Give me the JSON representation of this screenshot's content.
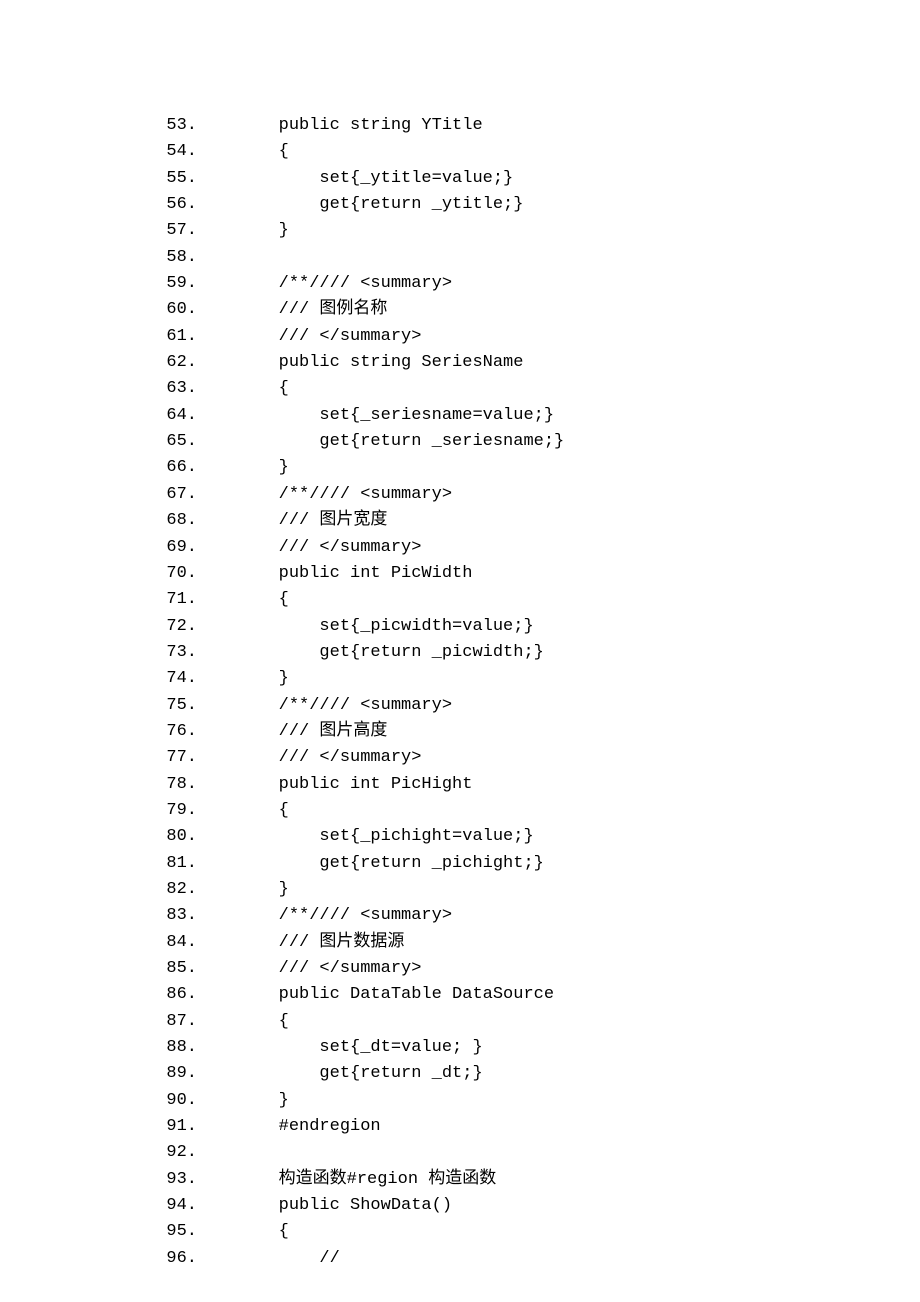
{
  "lines": [
    {
      "n": "53.",
      "t": "        public string YTitle"
    },
    {
      "n": "54.",
      "t": "        {"
    },
    {
      "n": "55.",
      "t": "            set{_ytitle=value;}"
    },
    {
      "n": "56.",
      "t": "            get{return _ytitle;}"
    },
    {
      "n": "57.",
      "t": "        }"
    },
    {
      "n": "58.",
      "t": "  "
    },
    {
      "n": "59.",
      "t": "        /**//// <summary>"
    },
    {
      "n": "60.",
      "t": "        /// 图例名称"
    },
    {
      "n": "61.",
      "t": "        /// </summary>"
    },
    {
      "n": "62.",
      "t": "        public string SeriesName"
    },
    {
      "n": "63.",
      "t": "        {"
    },
    {
      "n": "64.",
      "t": "            set{_seriesname=value;}"
    },
    {
      "n": "65.",
      "t": "            get{return _seriesname;}"
    },
    {
      "n": "66.",
      "t": "        }"
    },
    {
      "n": "67.",
      "t": "        /**//// <summary>"
    },
    {
      "n": "68.",
      "t": "        /// 图片宽度"
    },
    {
      "n": "69.",
      "t": "        /// </summary>"
    },
    {
      "n": "70.",
      "t": "        public int PicWidth"
    },
    {
      "n": "71.",
      "t": "        {"
    },
    {
      "n": "72.",
      "t": "            set{_picwidth=value;}"
    },
    {
      "n": "73.",
      "t": "            get{return _picwidth;}"
    },
    {
      "n": "74.",
      "t": "        }"
    },
    {
      "n": "75.",
      "t": "        /**//// <summary>"
    },
    {
      "n": "76.",
      "t": "        /// 图片高度"
    },
    {
      "n": "77.",
      "t": "        /// </summary>"
    },
    {
      "n": "78.",
      "t": "        public int PicHight"
    },
    {
      "n": "79.",
      "t": "        {"
    },
    {
      "n": "80.",
      "t": "            set{_pichight=value;}"
    },
    {
      "n": "81.",
      "t": "            get{return _pichight;}"
    },
    {
      "n": "82.",
      "t": "        }"
    },
    {
      "n": "83.",
      "t": "        /**//// <summary>"
    },
    {
      "n": "84.",
      "t": "        /// 图片数据源"
    },
    {
      "n": "85.",
      "t": "        /// </summary>"
    },
    {
      "n": "86.",
      "t": "        public DataTable DataSource"
    },
    {
      "n": "87.",
      "t": "        {"
    },
    {
      "n": "88.",
      "t": "            set{_dt=value; }"
    },
    {
      "n": "89.",
      "t": "            get{return _dt;}"
    },
    {
      "n": "90.",
      "t": "        }"
    },
    {
      "n": "91.",
      "t": "        #endregion"
    },
    {
      "n": "92.",
      "t": "  "
    },
    {
      "n": "93.",
      "t": "        构造函数#region 构造函数"
    },
    {
      "n": "94.",
      "t": "        public ShowData()"
    },
    {
      "n": "95.",
      "t": "        {"
    },
    {
      "n": "96.",
      "t": "            //"
    }
  ]
}
